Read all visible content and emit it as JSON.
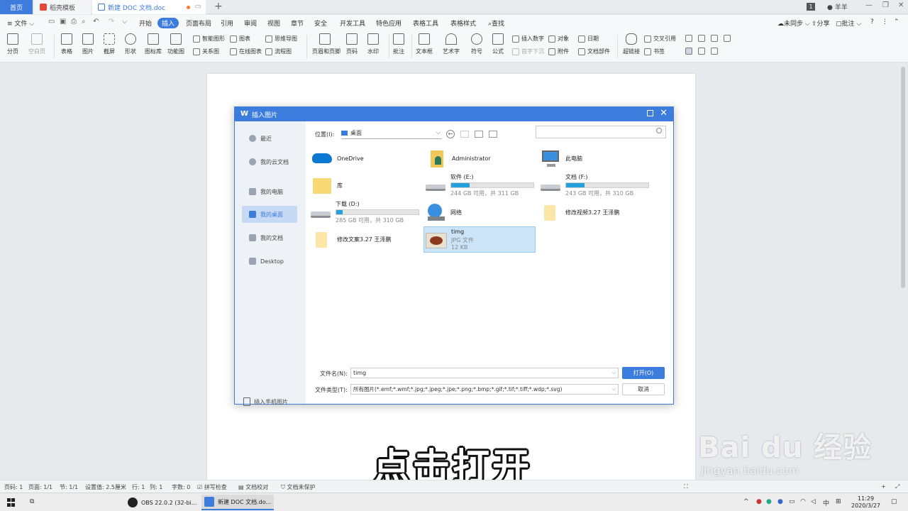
{
  "tabs": [
    {
      "label": "首页"
    },
    {
      "label": "稻壳模板"
    },
    {
      "label": "新建 DOC 文档.doc"
    }
  ],
  "titlebar": {
    "page_badge": "1",
    "user": "羊羊"
  },
  "menu": {
    "file": "文件",
    "items": [
      "开始",
      "插入",
      "页面布局",
      "引用",
      "审阅",
      "视图",
      "章节",
      "安全",
      "开发工具",
      "特色应用",
      "表格工具",
      "表格样式",
      "查找"
    ],
    "active": "插入",
    "right": {
      "sync": "未同步",
      "share": "分享",
      "comment": "批注"
    }
  },
  "toolbar": {
    "big": [
      "分页",
      "空白页",
      "表格",
      "图片",
      "截屏",
      "形状",
      "图标库",
      "功能图",
      "页眉和页脚",
      "页码",
      "水印",
      "批注",
      "文本框",
      "艺术字",
      "符号",
      "公式",
      "超链接"
    ],
    "small": {
      "smart_art": "智能图形",
      "chart": "图表",
      "mindmap": "思维导图",
      "relation": "关系图",
      "online_chart": "在线图表",
      "flowchart": "流程图",
      "insert_number": "插入数字",
      "object": "对象",
      "date": "日期",
      "drop_cap": "首字下沉",
      "attachment": "附件",
      "doc_parts": "文档部件",
      "cross_ref": "交叉引用",
      "bookmark": "书签"
    }
  },
  "dialog": {
    "title": "插入图片",
    "sidebar": [
      "最近",
      "我的云文档",
      "我的电脑",
      "我的桌面",
      "我的文档",
      "Desktop"
    ],
    "sidebar_selected": "我的桌面",
    "phone": "插入手机图片",
    "location_label": "位置(I):",
    "location_value": "桌面",
    "search_placeholder": "",
    "items": [
      {
        "name": "OneDrive",
        "icon": "onedrive-icon"
      },
      {
        "name": "Administrator",
        "icon": "user-folder-icon"
      },
      {
        "name": "此电脑",
        "icon": "computer-icon"
      },
      {
        "name": "库",
        "icon": "library-folder-icon"
      },
      {
        "name": "软件 (E:)",
        "sub": "244 GB 可用，共 311 GB",
        "fill": 0.22,
        "icon": "drive-icon"
      },
      {
        "name": "文档 (F:)",
        "sub": "243 GB 可用，共 310 GB",
        "fill": 0.22,
        "icon": "drive-icon"
      },
      {
        "name": "下载 (D:)",
        "sub": "285 GB 可用，共 310 GB",
        "fill": 0.08,
        "icon": "drive-icon"
      },
      {
        "name": "网络",
        "icon": "network-icon"
      },
      {
        "name": "修改视频3.27 王泽鹏",
        "icon": "folder-icon"
      },
      {
        "name": "修改文案3.27 王泽鹏",
        "icon": "folder-icon"
      },
      {
        "name": "timg",
        "sub": "JPG 文件",
        "sub2": "12 KB",
        "icon": "image-thumbnail-icon"
      }
    ],
    "selected_item": "timg",
    "filename_label": "文件名(N):",
    "filename_value": "timg",
    "filetype_label": "文件类型(T):",
    "filetype_value": "所有图片(*.emf;*.wmf;*.jpg;*.jpeg;*.jpe;*.png;*.bmp;*.gif;*.tif;*.tiff;*.wdp;*.svg)",
    "open_button": "打开(O)",
    "cancel_button": "取消"
  },
  "subtitle": "点击打开",
  "watermark": {
    "logo_text": "Bai du 经验",
    "url": "jingyan.baidu.com"
  },
  "statusbar": [
    "页码: 1",
    "页面: 1/1",
    "节: 1/1",
    "设置值: 2.5厘米",
    "行: 1",
    "列: 1",
    "字数: 0",
    "拼写检查",
    "文档校对",
    "文档未保护"
  ],
  "taskbar": {
    "apps": [
      "OBS 22.0.2 (32-bi...",
      "新建 DOC 文档.do..."
    ],
    "ime": "中",
    "time": "11:29",
    "date": "2020/3/27"
  },
  "colors": {
    "accent": "#3b7cdc",
    "drive_fill": "#26a0da",
    "folder": "#f8d775"
  }
}
